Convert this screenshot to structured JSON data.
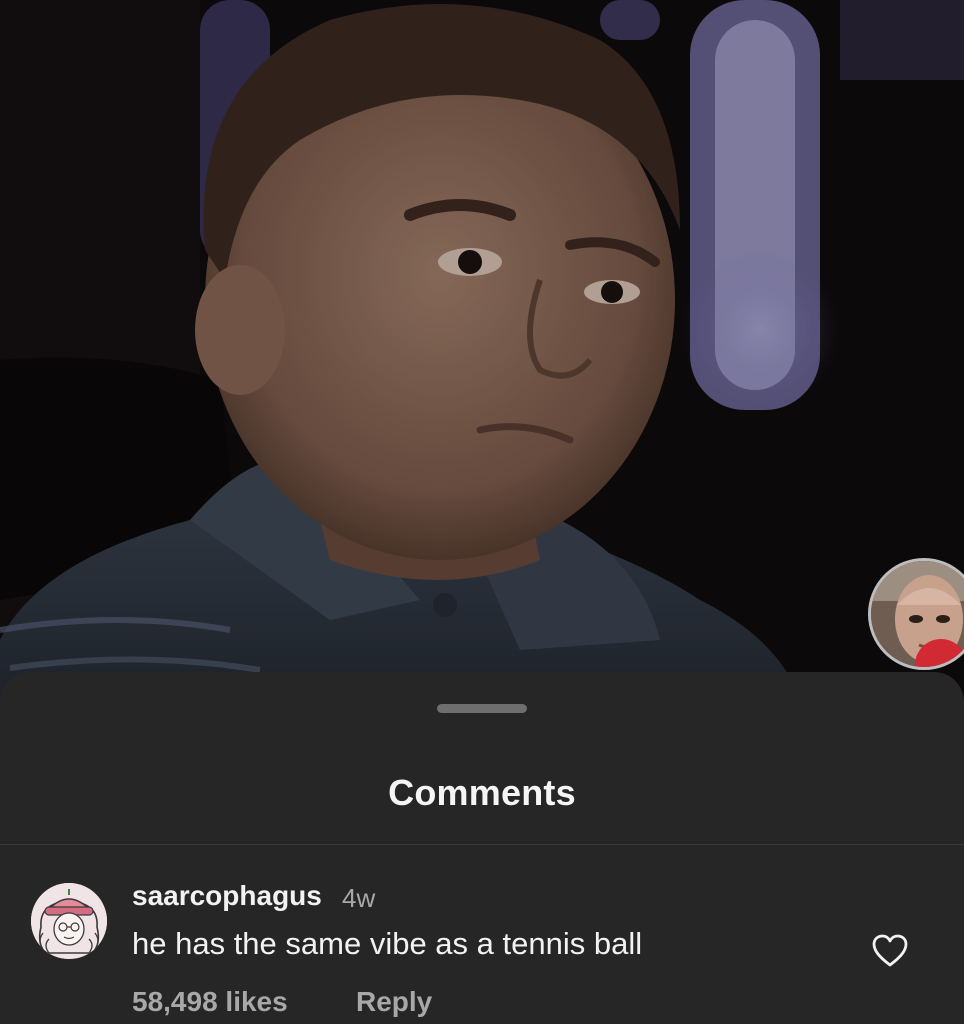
{
  "media": {
    "icon": "photo-of-boy"
  },
  "story_avatar": {
    "icon": "user-avatar-photo"
  },
  "sheet": {
    "title": "Comments"
  },
  "comments": [
    {
      "username": "saarcophagus",
      "time": "4w",
      "text": "he has the same vibe as a tennis ball",
      "likes": "58,498 likes",
      "reply_label": "Reply",
      "avatar_icon": "cartoon-avatar-icon",
      "like_icon": "heart-outline-icon"
    }
  ],
  "colors": {
    "sheet_background": "#262626",
    "primary_text": "#f2f2f2",
    "secondary_text": "#a8a8a8"
  }
}
